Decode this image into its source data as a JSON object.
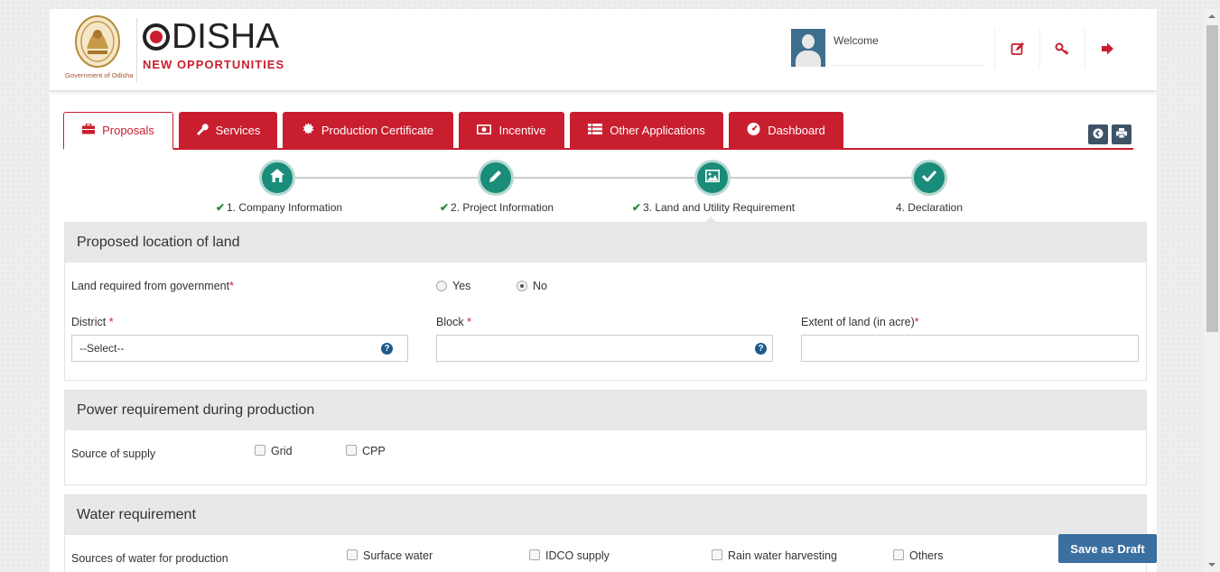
{
  "header": {
    "emblem_text": "Government of Odisha",
    "logo_title": "DISHA",
    "logo_subtitle": "NEW OPPORTUNITIES",
    "welcome": "Welcome"
  },
  "tabs": [
    {
      "label": "Proposals",
      "icon": "briefcase-icon"
    },
    {
      "label": "Services",
      "icon": "wrench-icon"
    },
    {
      "label": "Production Certificate",
      "icon": "certificate-icon"
    },
    {
      "label": "Incentive",
      "icon": "money-icon"
    },
    {
      "label": "Other Applications",
      "icon": "grid-icon"
    },
    {
      "label": "Dashboard",
      "icon": "dashboard-icon"
    }
  ],
  "steps": [
    {
      "label": "1. Company Information",
      "done": true,
      "icon": "home-icon"
    },
    {
      "label": "2. Project Information",
      "done": true,
      "icon": "pencil-icon"
    },
    {
      "label": "3. Land and Utility Requirement",
      "done": true,
      "icon": "image-icon"
    },
    {
      "label": "4. Declaration",
      "done": false,
      "icon": "check-icon"
    }
  ],
  "land": {
    "title": "Proposed location of land",
    "gov_label": "Land required from government",
    "yes": "Yes",
    "no": "No",
    "selected": "No",
    "district_label": "District",
    "district_value": "--Select--",
    "block_label": "Block",
    "block_value": "",
    "extent_label": "Extent of land (in acre)",
    "extent_value": ""
  },
  "power": {
    "title": "Power requirement during production",
    "source_label": "Source of supply",
    "options": [
      "Grid",
      "CPP"
    ]
  },
  "water": {
    "title": "Water requirement",
    "source_label": "Sources of water for production",
    "options": [
      "Surface water",
      "IDCO supply",
      "Rain water harvesting",
      "Others"
    ]
  },
  "save_draft": "Save as Draft",
  "colors": {
    "brand": "#c81e2e",
    "step": "#1a8c7a",
    "button": "#3a6fa0"
  }
}
